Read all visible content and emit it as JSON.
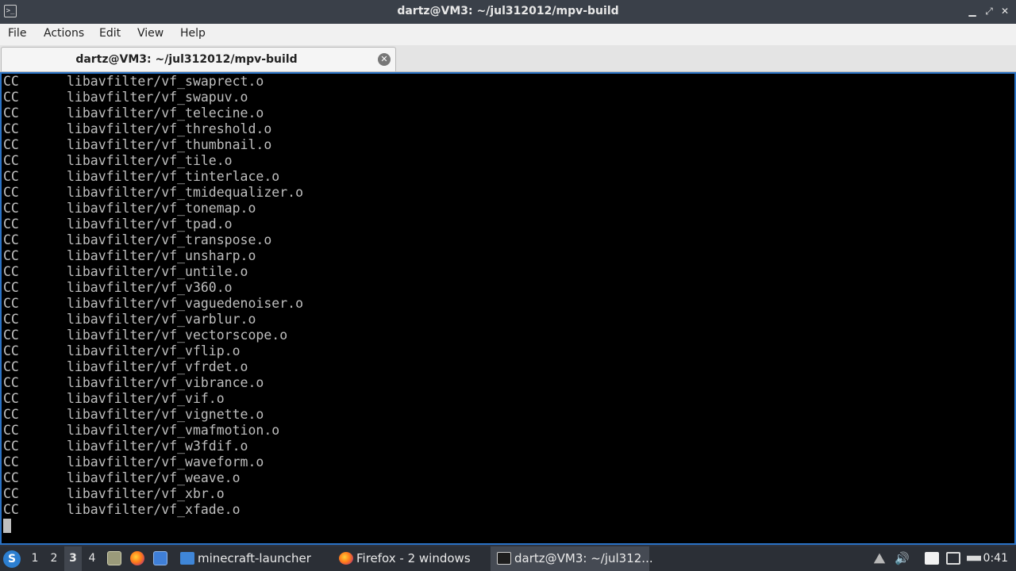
{
  "window": {
    "title": "dartz@VM3: ~/jul312012/mpv-build",
    "icon": "terminal-icon",
    "controls": [
      "minimize-icon",
      "maximize-icon",
      "close-icon"
    ]
  },
  "menu": {
    "file": "File",
    "actions": "Actions",
    "edit": "Edit",
    "view": "View",
    "help": "Help"
  },
  "tab": {
    "label": "dartz@VM3: ~/jul312012/mpv-build",
    "close_icon": "close-circle-icon"
  },
  "terminal": {
    "lines": [
      {
        "cmd": "CC",
        "path": "libavfilter/vf_swaprect.o"
      },
      {
        "cmd": "CC",
        "path": "libavfilter/vf_swapuv.o"
      },
      {
        "cmd": "CC",
        "path": "libavfilter/vf_telecine.o"
      },
      {
        "cmd": "CC",
        "path": "libavfilter/vf_threshold.o"
      },
      {
        "cmd": "CC",
        "path": "libavfilter/vf_thumbnail.o"
      },
      {
        "cmd": "CC",
        "path": "libavfilter/vf_tile.o"
      },
      {
        "cmd": "CC",
        "path": "libavfilter/vf_tinterlace.o"
      },
      {
        "cmd": "CC",
        "path": "libavfilter/vf_tmidequalizer.o"
      },
      {
        "cmd": "CC",
        "path": "libavfilter/vf_tonemap.o"
      },
      {
        "cmd": "CC",
        "path": "libavfilter/vf_tpad.o"
      },
      {
        "cmd": "CC",
        "path": "libavfilter/vf_transpose.o"
      },
      {
        "cmd": "CC",
        "path": "libavfilter/vf_unsharp.o"
      },
      {
        "cmd": "CC",
        "path": "libavfilter/vf_untile.o"
      },
      {
        "cmd": "CC",
        "path": "libavfilter/vf_v360.o"
      },
      {
        "cmd": "CC",
        "path": "libavfilter/vf_vaguedenoiser.o"
      },
      {
        "cmd": "CC",
        "path": "libavfilter/vf_varblur.o"
      },
      {
        "cmd": "CC",
        "path": "libavfilter/vf_vectorscope.o"
      },
      {
        "cmd": "CC",
        "path": "libavfilter/vf_vflip.o"
      },
      {
        "cmd": "CC",
        "path": "libavfilter/vf_vfrdet.o"
      },
      {
        "cmd": "CC",
        "path": "libavfilter/vf_vibrance.o"
      },
      {
        "cmd": "CC",
        "path": "libavfilter/vf_vif.o"
      },
      {
        "cmd": "CC",
        "path": "libavfilter/vf_vignette.o"
      },
      {
        "cmd": "CC",
        "path": "libavfilter/vf_vmafmotion.o"
      },
      {
        "cmd": "CC",
        "path": "libavfilter/vf_w3fdif.o"
      },
      {
        "cmd": "CC",
        "path": "libavfilter/vf_waveform.o"
      },
      {
        "cmd": "CC",
        "path": "libavfilter/vf_weave.o"
      },
      {
        "cmd": "CC",
        "path": "libavfilter/vf_xbr.o"
      },
      {
        "cmd": "CC",
        "path": "libavfilter/vf_xfade.o"
      }
    ]
  },
  "taskbar": {
    "start_icon": "lxqt-start-icon",
    "workspaces": [
      "1",
      "2",
      "3",
      "4"
    ],
    "active_workspace": "3",
    "quicklaunch": [
      "show-desktop-icon",
      "firefox-icon",
      "desktop-icon"
    ],
    "tasks": [
      {
        "label": "minecraft-launcher",
        "icon": "folder-icon"
      },
      {
        "label": "Firefox - 2 windows",
        "icon": "firefox-icon"
      },
      {
        "label": "dartz@VM3: ~/jul312...",
        "icon": "terminal-icon"
      }
    ],
    "tray": [
      "updates-icon",
      "volume-icon",
      "clipboard-icon",
      "display-icon",
      "network-icon"
    ],
    "clock": "0:41"
  },
  "colors": {
    "accent": "#2a72c5",
    "terminal_bg": "#000000",
    "terminal_fg": "#bfbfbf"
  }
}
